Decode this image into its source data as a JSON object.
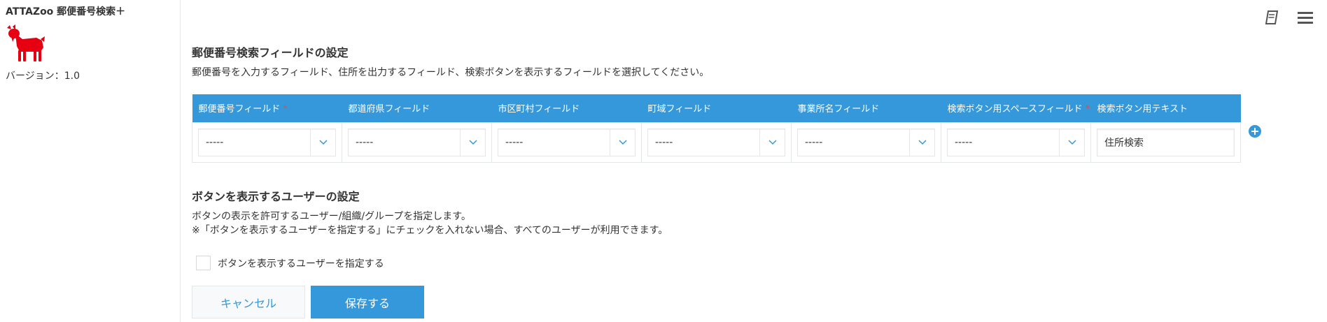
{
  "app": {
    "title": "ATTAZoo 郵便番号検索＋",
    "version": "バージョン：1.0",
    "logo_icon": "goat-icon",
    "logo_color": "#e60012"
  },
  "toolbar": {
    "manual_icon": "book-icon",
    "menu_icon": "hamburger-menu-icon"
  },
  "field_section": {
    "title": "郵便番号検索フィールドの設定",
    "description": "郵便番号を入力するフィールド、住所を出力するフィールド、検索ボタンを表示するフィールドを選択してください。",
    "columns": [
      {
        "label": "郵便番号フィールド",
        "required": "*"
      },
      {
        "label": "都道府県フィールド"
      },
      {
        "label": "市区町村フィールド"
      },
      {
        "label": "町域フィールド"
      },
      {
        "label": "事業所名フィールド"
      },
      {
        "label": "検索ボタン用スペースフィールド",
        "required": "*"
      },
      {
        "label": "検索ボタン用テキスト"
      }
    ],
    "row": {
      "selects": [
        "-----",
        "-----",
        "-----",
        "-----",
        "-----",
        "-----"
      ],
      "button_text": "住所検索"
    },
    "add_row_icon": "plus-circle-icon"
  },
  "user_section": {
    "title": "ボタンを表示するユーザーの設定",
    "description_line1": "ボタンの表示を許可するユーザー/組織/グループを指定します。",
    "description_line2": "※「ボタンを表示するユーザーを指定する」にチェックを入れない場合、すべてのユーザーが利用できます。",
    "checkbox_label": "ボタンを表示するユーザーを指定する",
    "checkbox_checked": false
  },
  "actions": {
    "cancel_label": "キャンセル",
    "save_label": "保存する"
  },
  "colors": {
    "accent": "#3498db",
    "required": "#e74c3c"
  }
}
